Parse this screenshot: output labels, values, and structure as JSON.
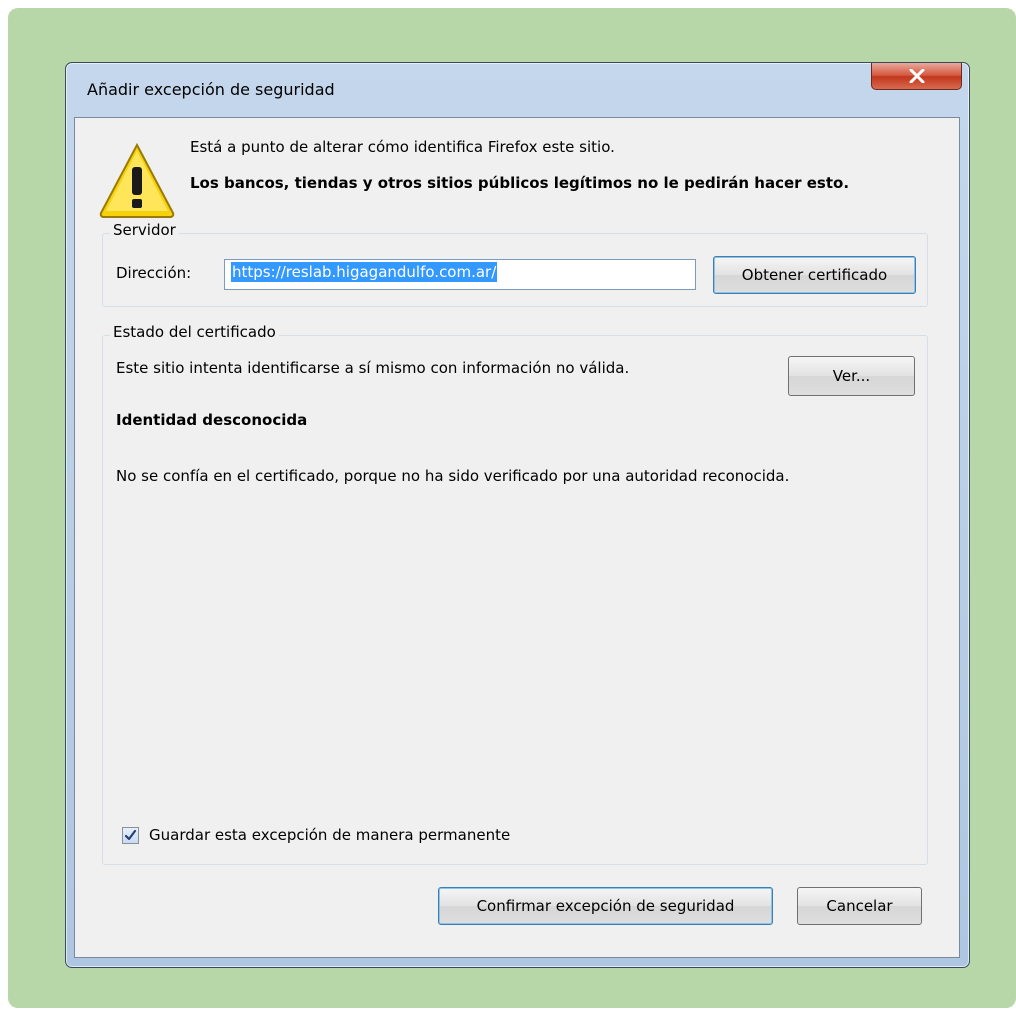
{
  "dialog": {
    "title": "Añadir excepción de seguridad",
    "close_glyph": "x",
    "message_line1": "Está a punto de alterar cómo identifica Firefox este sitio.",
    "message_line2": "Los bancos, tiendas y otros sitios públicos legítimos no le pedirán hacer esto."
  },
  "server_group": {
    "title": "Servidor",
    "address_label": "Dirección:",
    "address_value": "https://reslab.higagandulfo.com.ar/",
    "get_cert_button": "Obtener certificado"
  },
  "cert_status_group": {
    "title": "Estado del certificado",
    "description": "Este sitio intenta identificarse a sí mismo con información no válida.",
    "view_button": "Ver...",
    "identity_heading": "Identidad desconocida",
    "trust_message": "No se confía en el certificado, porque no ha sido verificado por una autoridad reconocida.",
    "save_permanent_label": "Guardar esta excepción de manera permanente",
    "save_permanent_checked": true
  },
  "footer": {
    "confirm_button": "Confirmar excepción de seguridad",
    "cancel_button": "Cancelar"
  },
  "icons": {
    "warning": "warning-triangle-icon",
    "close": "close-icon",
    "check": "checkmark-icon"
  },
  "colors": {
    "background_panel": "#b7d7a8",
    "selection": "#3399ff",
    "close_button": "#c2361c",
    "warning_yellow": "#f5d20c"
  }
}
